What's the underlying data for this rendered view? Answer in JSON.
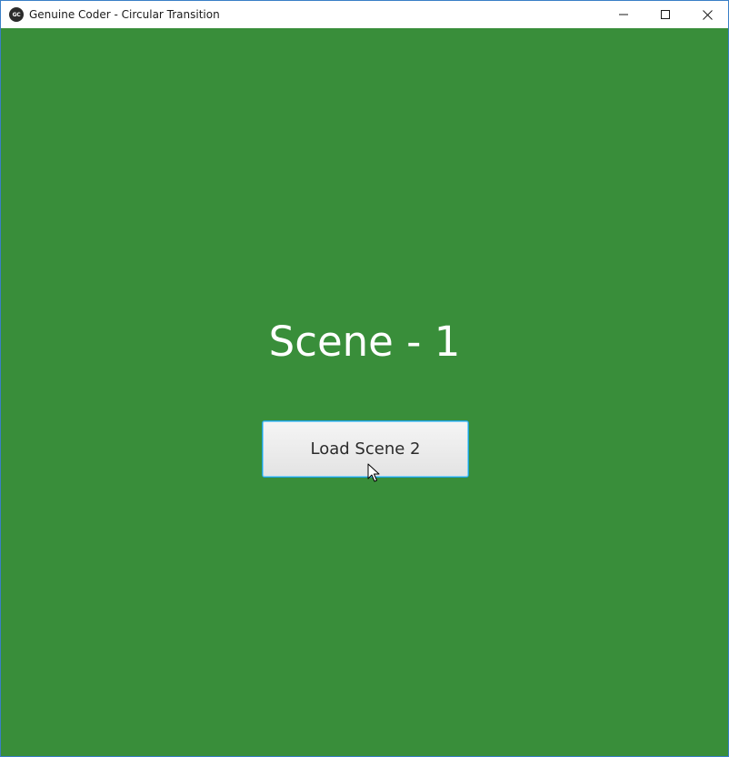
{
  "window": {
    "title": "Genuine Coder - Circular Transition",
    "app_icon_text": "GC",
    "controls": {
      "minimize_icon": "minimize-icon",
      "maximize_icon": "maximize-icon",
      "close_icon": "close-icon"
    }
  },
  "scene": {
    "heading": "Scene - 1",
    "button_label": "Load Scene 2",
    "background_color": "#398e3a"
  },
  "cursor": {
    "icon": "mouse-pointer-icon"
  }
}
